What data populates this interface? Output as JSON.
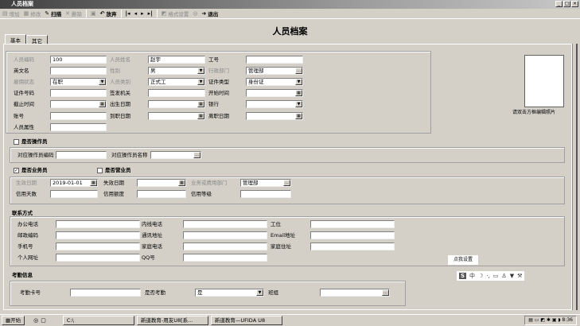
{
  "window": {
    "title": "人员档案",
    "min": "_",
    "max": "□",
    "close": "×"
  },
  "toolbar": [
    {
      "icon": "add-icon",
      "glyph": "▤",
      "label": "增加",
      "on": false
    },
    {
      "icon": "edit-icon",
      "glyph": "▦",
      "label": "修改",
      "on": false
    },
    {
      "icon": "scan-icon",
      "glyph": "✎",
      "label": "扫描",
      "on": true
    },
    {
      "icon": "delete-icon",
      "glyph": "✕",
      "label": "删除",
      "on": false
    },
    {
      "icon": "save-icon",
      "glyph": "▣",
      "label": "",
      "on": false
    },
    {
      "icon": "undo-icon",
      "glyph": "↶",
      "label": "放弃",
      "on": true
    },
    {
      "icon": "first-icon",
      "glyph": "|◂",
      "label": "",
      "on": true
    },
    {
      "icon": "prev-icon",
      "glyph": "◂",
      "label": "",
      "on": true
    },
    {
      "icon": "next-icon",
      "glyph": "▸",
      "label": "",
      "on": true
    },
    {
      "icon": "last-icon",
      "glyph": "▸|",
      "label": "",
      "on": true
    },
    {
      "icon": "format-icon",
      "glyph": "◩",
      "label": "格式设置",
      "on": false
    },
    {
      "icon": "help-icon",
      "glyph": "◎",
      "label": "",
      "on": false
    },
    {
      "icon": "exit-icon",
      "glyph": "➜",
      "label": "退出",
      "on": true
    }
  ],
  "heading": "人员档案",
  "tabs": [
    "基本",
    "其它"
  ],
  "basic": {
    "fields": [
      {
        "label": "人员编码",
        "value": "100",
        "dim": true,
        "kind": "text"
      },
      {
        "label": "人员姓名",
        "value": "赵宇",
        "dim": true,
        "kind": "text"
      },
      {
        "label": "工号",
        "value": "",
        "dim": false,
        "kind": "text"
      },
      {
        "label": "英文名",
        "value": "",
        "dim": false,
        "kind": "text"
      },
      {
        "label": "性别",
        "value": "男",
        "dim": true,
        "kind": "select"
      },
      {
        "label": "行政部门",
        "value": "管理部",
        "dim": true,
        "kind": "ref"
      },
      {
        "label": "雇佣状态",
        "value": "在职",
        "dim": true,
        "kind": "select"
      },
      {
        "label": "人员类别",
        "value": "正式工",
        "dim": true,
        "kind": "select"
      },
      {
        "label": "证件类型",
        "value": "身份证",
        "dim": false,
        "kind": "select"
      },
      {
        "label": "证件号码",
        "value": "",
        "dim": false,
        "kind": "text"
      },
      {
        "label": "签发机关",
        "value": "",
        "dim": false,
        "kind": "text"
      },
      {
        "label": "开始时间",
        "value": "",
        "dim": false,
        "kind": "date"
      },
      {
        "label": "截止时间",
        "value": "",
        "dim": false,
        "kind": "date"
      },
      {
        "label": "出生日期",
        "value": "",
        "dim": false,
        "kind": "date"
      },
      {
        "label": "银行",
        "value": "",
        "dim": false,
        "kind": "select"
      },
      {
        "label": "账号",
        "value": "",
        "dim": false,
        "kind": "text"
      },
      {
        "label": "到职日期",
        "value": "",
        "dim": false,
        "kind": "date"
      },
      {
        "label": "离职日期",
        "value": "",
        "dim": false,
        "kind": "date"
      },
      {
        "label": "人员属性",
        "value": "",
        "dim": false,
        "kind": "text"
      }
    ],
    "photo_caption": "请双击方框编辑照片"
  },
  "operator": {
    "check_label": "是否操作员",
    "checked": false,
    "fields": [
      {
        "label": "对应操作员编码",
        "value": ""
      },
      {
        "label": "对应操作员名称",
        "value": ""
      }
    ]
  },
  "business": {
    "check_label": "是否业务员",
    "checked": true,
    "sales_label": "是否营业员",
    "sales_checked": false,
    "fields": [
      {
        "label": "生效日期",
        "value": "2019-01-01",
        "dim": true,
        "kind": "date"
      },
      {
        "label": "失效日期",
        "value": "",
        "dim": false,
        "kind": "date"
      },
      {
        "label": "业务或费用部门",
        "value": "管理部",
        "dim": true,
        "kind": "ref"
      },
      {
        "label": "信用天数",
        "value": "",
        "dim": false,
        "kind": "text"
      },
      {
        "label": "信用额度",
        "value": "",
        "dim": false,
        "kind": "text"
      },
      {
        "label": "信用等级",
        "value": "",
        "dim": false,
        "kind": "text"
      }
    ]
  },
  "contact": {
    "title": "联系方式",
    "fields": [
      {
        "label": "办公电话",
        "value": ""
      },
      {
        "label": "内线电话",
        "value": ""
      },
      {
        "label": "工位",
        "value": ""
      },
      {
        "label": "邮政编码",
        "value": ""
      },
      {
        "label": "通讯地址",
        "value": ""
      },
      {
        "label": "Email地址",
        "value": ""
      },
      {
        "label": "手机号",
        "value": ""
      },
      {
        "label": "家庭电话",
        "value": ""
      },
      {
        "label": "家庭住址",
        "value": ""
      },
      {
        "label": "个人网址",
        "value": ""
      },
      {
        "label": "QQ号",
        "value": ""
      }
    ]
  },
  "attendance": {
    "title": "考勤信息",
    "fields": [
      {
        "label": "考勤卡号",
        "value": "",
        "kind": "text"
      },
      {
        "label": "是否考勤",
        "value": "是",
        "kind": "select"
      },
      {
        "label": "班组",
        "value": "",
        "kind": "ref"
      }
    ]
  },
  "ime": {
    "tooltip": "点我设置",
    "logo": "S",
    "mode": "中",
    "icons": [
      "moon-icon",
      "punctuation-icon",
      "keyboard-icon",
      "user-icon",
      "skin-icon",
      "wrench-icon"
    ],
    "glyphs": [
      "☽",
      "·,",
      "▭",
      "♙",
      "▼",
      "⚒"
    ]
  },
  "taskbar": {
    "start": "开始",
    "tasks": [
      "C:\\",
      "新道教育-用友U8[系...",
      "新道教育—UFIDA U8"
    ],
    "clock": "8:36"
  }
}
